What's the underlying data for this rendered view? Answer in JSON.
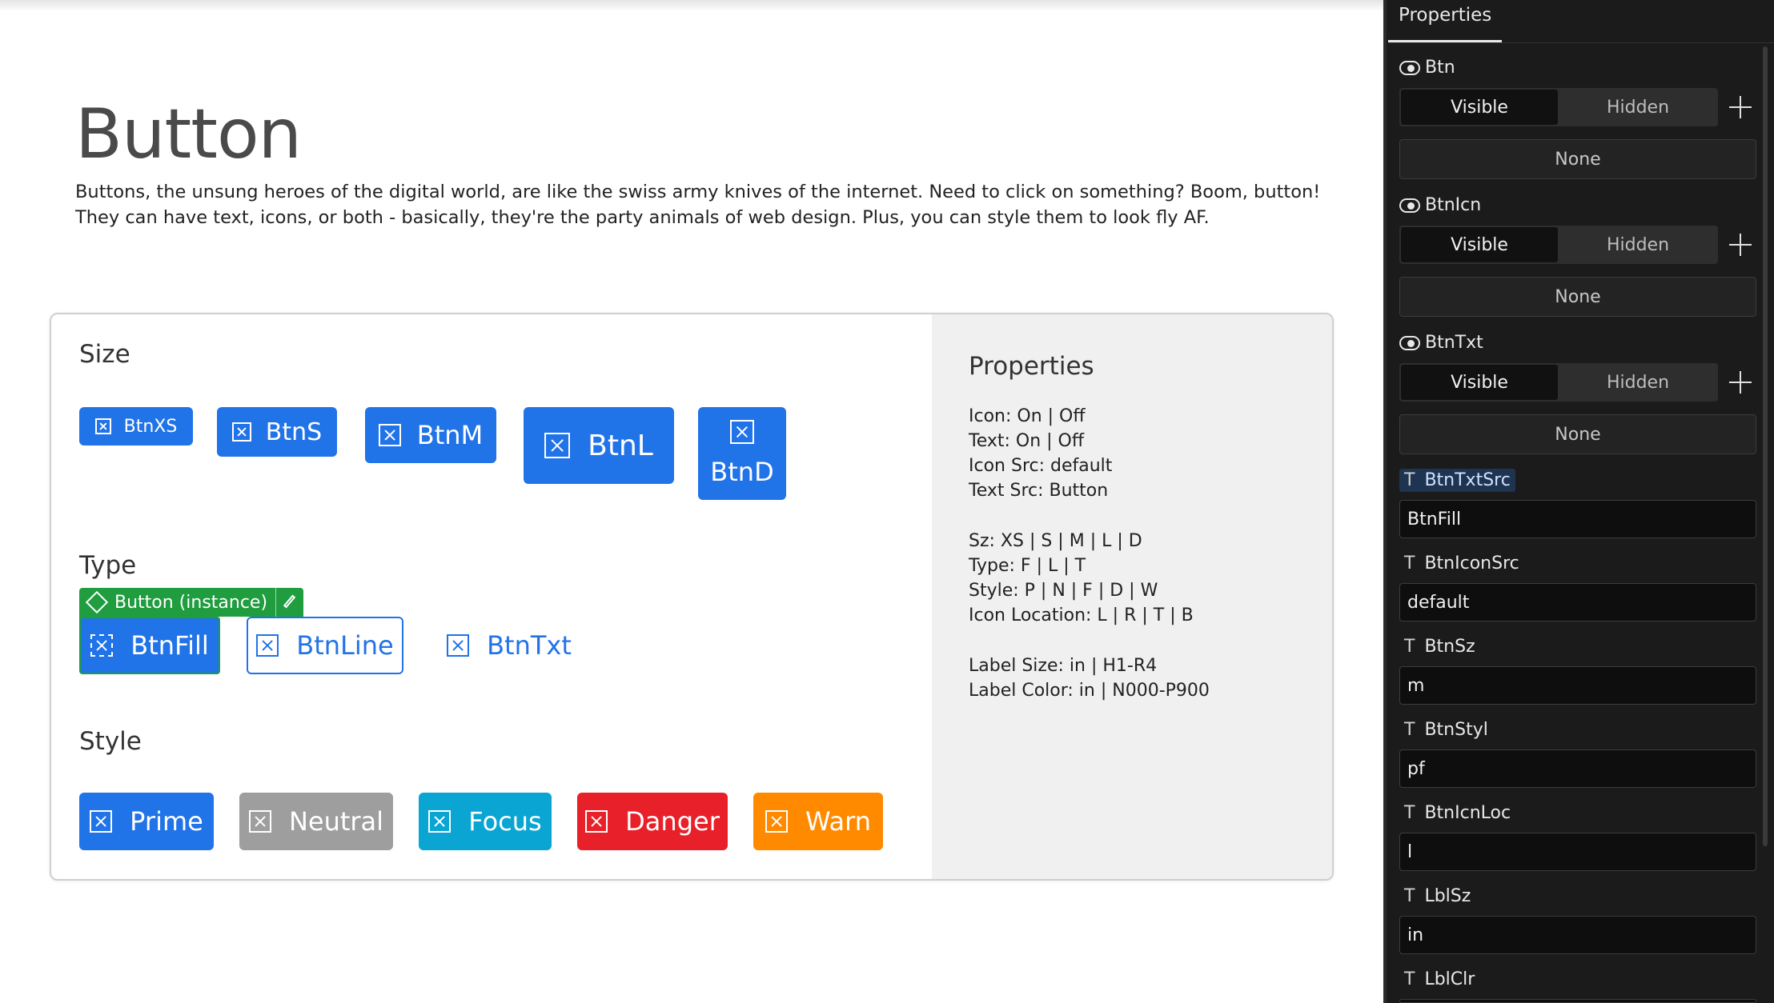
{
  "doc": {
    "title": "Button",
    "description": "Buttons, the unsung heroes of the digital world, are like the swiss army knives of the internet. Need to click on something? Boom, button! They can have text, icons, or both - basically, they're the party animals of web design. Plus, you can style them to look fly AF."
  },
  "card": {
    "size_title": "Size",
    "type_title": "Type",
    "style_title": "Style",
    "size_buttons": [
      "BtnXS",
      "BtnS",
      "BtnM",
      "BtnL",
      "BtnD"
    ],
    "type_buttons": [
      "BtnFill",
      "BtnLine",
      "BtnTxt"
    ],
    "instance_badge": "Button (instance)",
    "style_buttons": [
      "Prime",
      "Neutral",
      "Focus",
      "Danger",
      "Warn"
    ],
    "style_colors": {
      "prime": "#2173e8",
      "neutral": "#9e9e9e",
      "focus": "#0aa5d3",
      "danger": "#e8202a",
      "warn": "#ff8a00"
    },
    "props_title": "Properties",
    "props_lines": [
      "Icon: On | Off",
      "Text: On | Off",
      "Icon Src: default",
      "Text Src: Button",
      "Sz: XS | S | M | L | D",
      "Type: F | L | T",
      "Style: P | N | F | D | W",
      "Icon Location: L | R | T | B",
      "Label Size: in | H1-R4",
      "Label Color: in | N000-P900"
    ]
  },
  "panel": {
    "tab": "Properties",
    "toggles": [
      {
        "label": "Btn",
        "on": "Visible",
        "off": "Hidden",
        "value": "None"
      },
      {
        "label": "BtnIcn",
        "on": "Visible",
        "off": "Hidden",
        "value": "None"
      },
      {
        "label": "BtnTxt",
        "on": "Visible",
        "off": "Hidden",
        "value": "None"
      }
    ],
    "text_props": [
      {
        "label": "BtnTxtSrc",
        "value": "BtnFill"
      },
      {
        "label": "BtnIconSrc",
        "value": "default"
      },
      {
        "label": "BtnSz",
        "value": "m"
      },
      {
        "label": "BtnStyl",
        "value": "pf"
      },
      {
        "label": "BtnIcnLoc",
        "value": "l"
      },
      {
        "label": "LblSz",
        "value": "in"
      },
      {
        "label": "LblClr",
        "value": ""
      }
    ],
    "text_glyph": "T"
  }
}
